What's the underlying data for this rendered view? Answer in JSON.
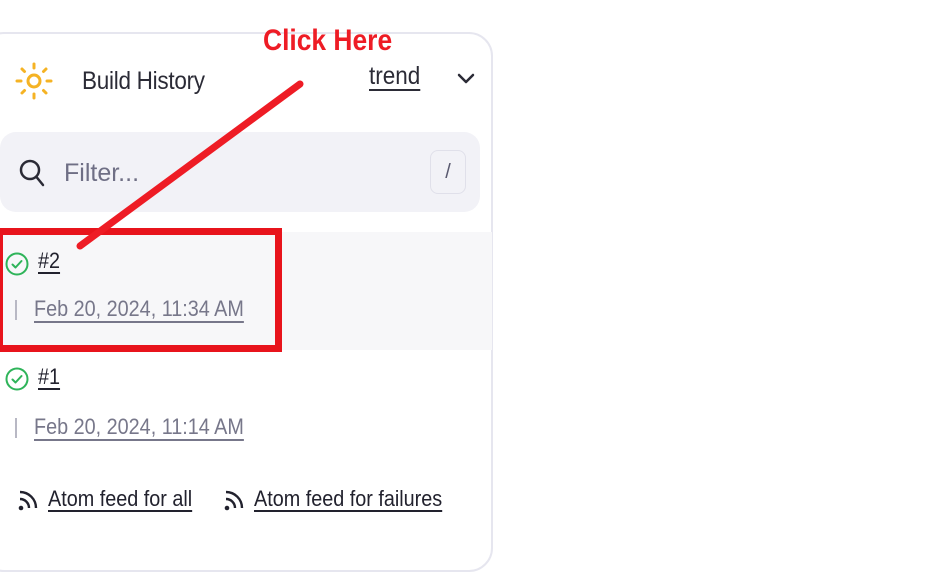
{
  "widget": {
    "icon": "sun-icon",
    "title": "Build History",
    "trend_label": "trend",
    "trend_dropdown_icon": "chevron-down-icon"
  },
  "filter": {
    "placeholder": "Filter...",
    "value": "",
    "shortcut_key": "/"
  },
  "builds": [
    {
      "number": "#2",
      "timestamp": "Feb 20, 2024, 11:34 AM",
      "status": "success",
      "status_icon": "check-circle-icon"
    },
    {
      "number": "#1",
      "timestamp": "Feb 20, 2024, 11:14 AM",
      "status": "success",
      "status_icon": "check-circle-icon"
    }
  ],
  "feeds": [
    {
      "label": "Atom feed for all",
      "icon": "rss-icon"
    },
    {
      "label": "Atom feed for failures",
      "icon": "rss-icon"
    }
  ],
  "annotation": {
    "callout_text": "Click Here",
    "color": "#ee1c25"
  },
  "colors": {
    "sun": "#f5b324",
    "success": "#2fb45a",
    "filter_bg": "#f2f2f7",
    "highlight": "#e8141c"
  }
}
